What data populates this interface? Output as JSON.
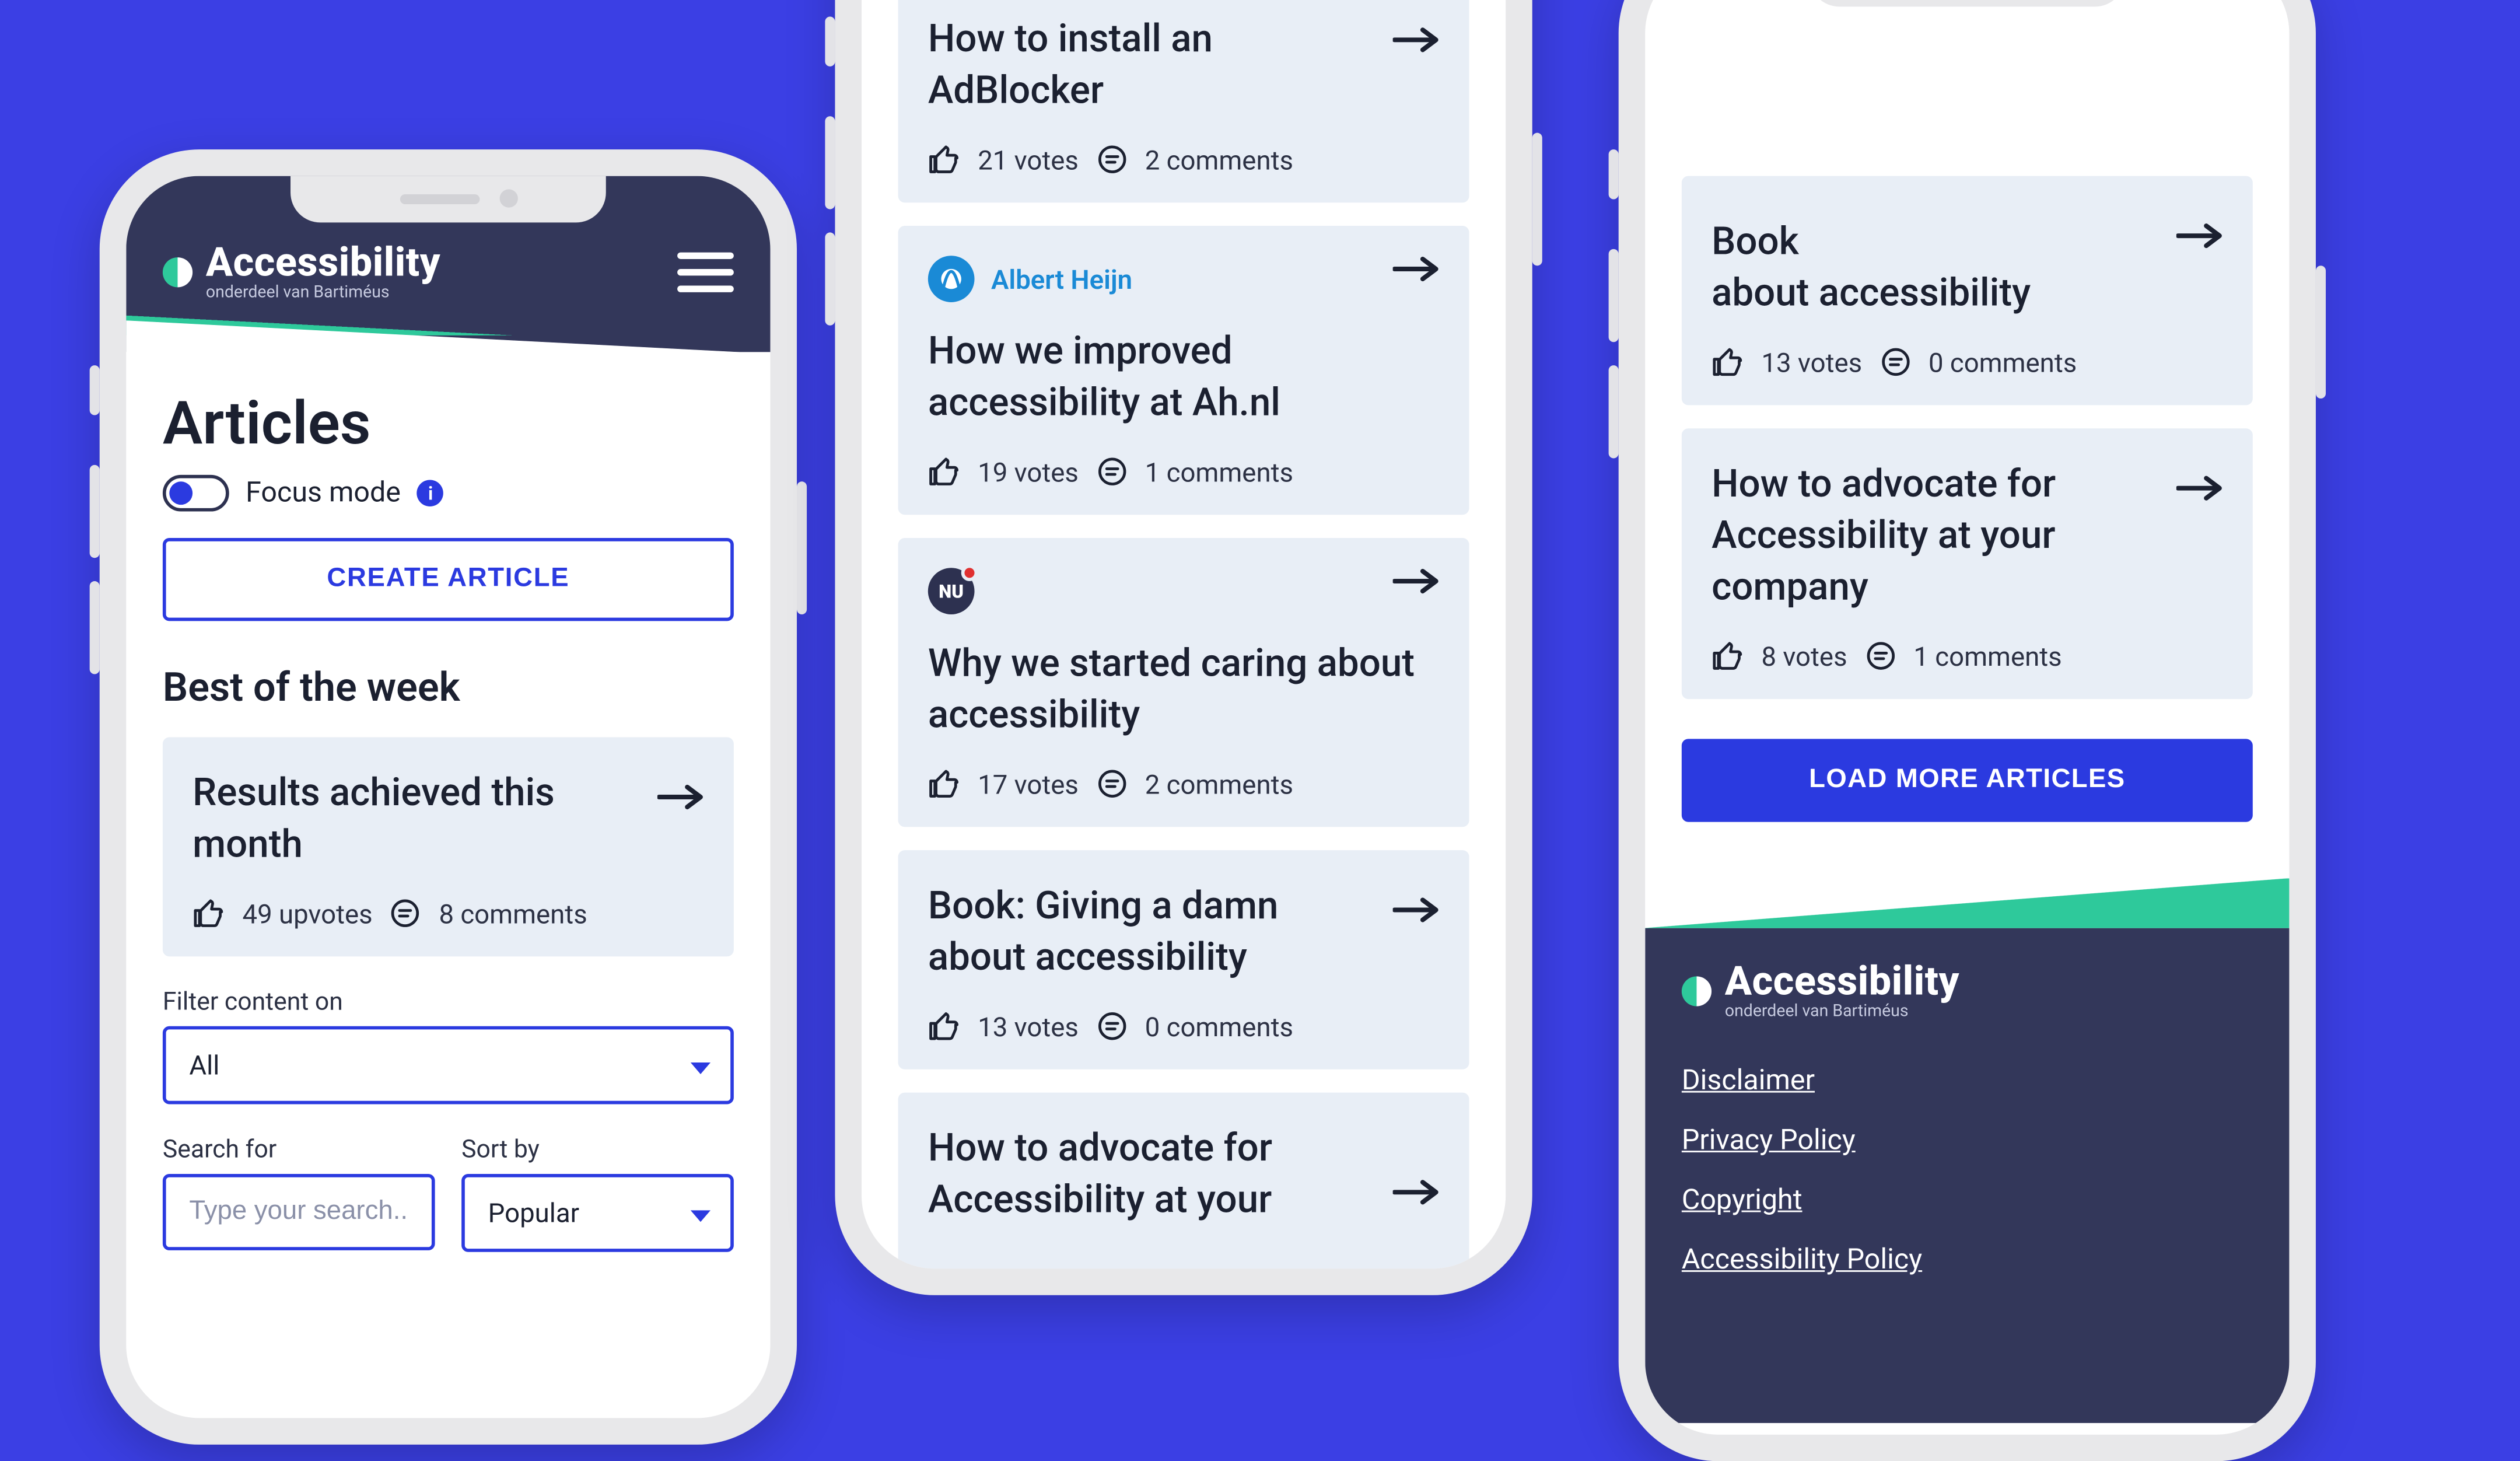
{
  "brand": {
    "name": "Accessibility",
    "tagline": "onderdeel van Bartiméus"
  },
  "phone1": {
    "page_title": "Articles",
    "focus_label": "Focus mode",
    "create_button": "CREATE ARTICLE",
    "best_heading": "Best of the week",
    "best_card": {
      "title": "Results achieved this month",
      "upvotes": "49 upvotes",
      "comments": "8 comments"
    },
    "filter_label": "Filter content on",
    "filter_value": "All",
    "search_label": "Search for",
    "search_placeholder": "Type your search...",
    "sort_label": "Sort by",
    "sort_value": "Popular"
  },
  "phone2": {
    "cards": [
      {
        "title_line1": "How to install an",
        "title_line2": "AdBlocker",
        "votes": "21 votes",
        "comments": "2 comments",
        "brand": null
      },
      {
        "title": "How we improved accessibility at Ah.nl",
        "votes": "19  votes",
        "comments": "1 comments",
        "brand": {
          "label": "Albert Heijn",
          "color": "#1a8ad6"
        }
      },
      {
        "title": "Why we started caring about accessibility",
        "votes": "17 votes",
        "comments": "2 comments",
        "brand": {
          "label": "",
          "color": "#2d3150"
        }
      },
      {
        "title": "Book: Giving a damn about accessibility",
        "votes": "13 votes",
        "comments": "0 comments",
        "brand": null
      },
      {
        "title": "How to advocate for Accessibility at your",
        "brand": null
      }
    ]
  },
  "phone3": {
    "cards": [
      {
        "title": "Book about accessibility",
        "votes": "13 votes",
        "comments": "0 comments"
      },
      {
        "title": "How to advocate for Accessibility at your company",
        "votes": "8 votes",
        "comments": "1 comments"
      }
    ],
    "load_more": "LOAD MORE ARTICLES",
    "footer_links": [
      "Disclaimer",
      "Privacy Policy",
      "Copyright",
      "Accessibility Policy"
    ]
  },
  "icons": {
    "thumb": "thumb-up-icon",
    "comment": "comment-icon",
    "arrow": "arrow-right-icon",
    "menu": "menu-icon",
    "info": "info-icon"
  }
}
